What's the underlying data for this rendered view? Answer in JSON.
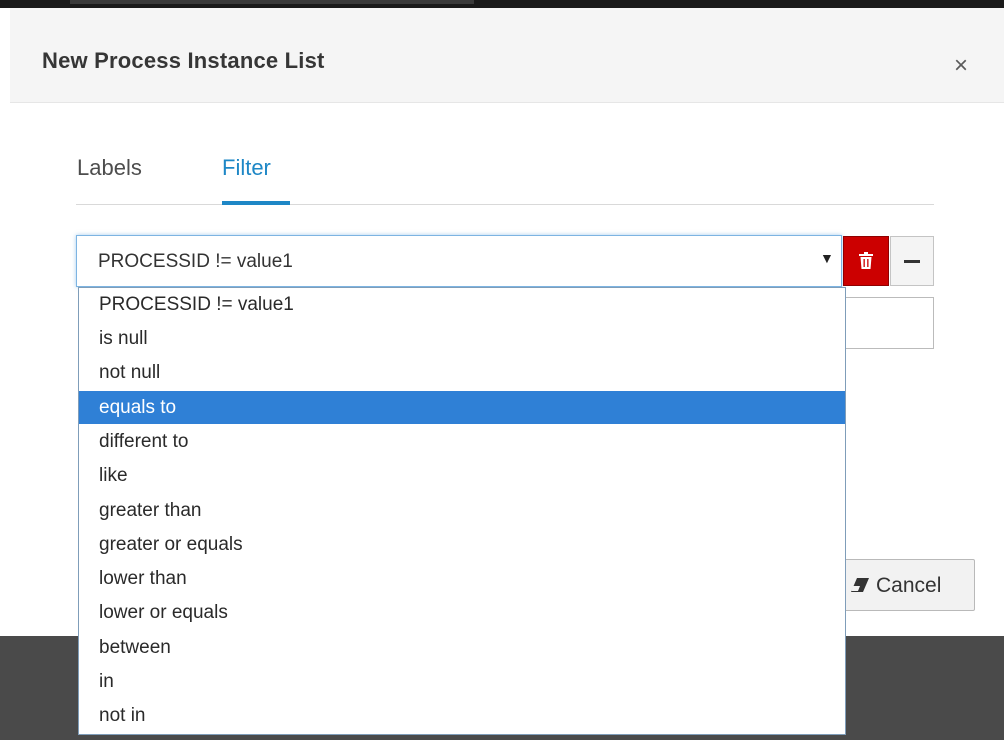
{
  "dialog": {
    "title": "New Process Instance List",
    "close_label": "×"
  },
  "tabs": [
    {
      "label": "Labels",
      "active": false
    },
    {
      "label": "Filter",
      "active": true
    }
  ],
  "filter": {
    "selected_value": "PROCESSID != value1",
    "options": [
      "PROCESSID != value1",
      "is null",
      "not null",
      "equals to",
      "different to",
      "like",
      "greater than",
      "greater or equals",
      "lower than",
      "lower or equals",
      "between",
      "in",
      "not in"
    ],
    "highlighted_option": "equals to"
  },
  "footer": {
    "cancel_label": "Cancel"
  },
  "colors": {
    "accent": "#1e87c6",
    "danger": "#cc0000",
    "highlight": "#2f80d6"
  }
}
